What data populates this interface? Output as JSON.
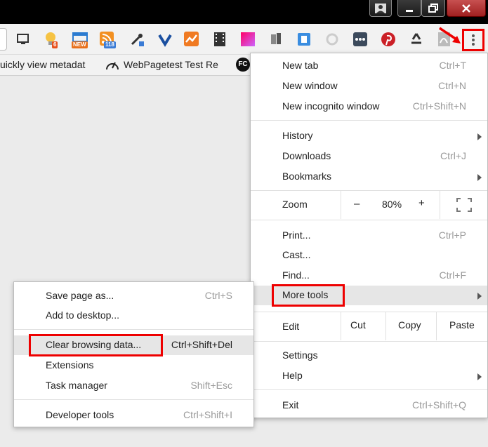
{
  "toolbar": {
    "badges": {
      "b1": "6",
      "b2": "NEW",
      "b3": "118"
    }
  },
  "bookmarks": {
    "item1": "uickly view metadat",
    "item2": "WebPagetest Test Re",
    "item3_icon_text": "FC"
  },
  "menu": {
    "new_tab": {
      "label": "New tab",
      "shortcut": "Ctrl+T"
    },
    "new_window": {
      "label": "New window",
      "shortcut": "Ctrl+N"
    },
    "incognito": {
      "label": "New incognito window",
      "shortcut": "Ctrl+Shift+N"
    },
    "history": {
      "label": "History"
    },
    "downloads": {
      "label": "Downloads",
      "shortcut": "Ctrl+J"
    },
    "bookmarks": {
      "label": "Bookmarks"
    },
    "zoom": {
      "label": "Zoom",
      "minus": "–",
      "value": "80%",
      "plus": "+"
    },
    "print": {
      "label": "Print...",
      "shortcut": "Ctrl+P"
    },
    "cast": {
      "label": "Cast..."
    },
    "find": {
      "label": "Find...",
      "shortcut": "Ctrl+F"
    },
    "more_tools": {
      "label": "More tools"
    },
    "edit": {
      "label": "Edit",
      "cut": "Cut",
      "copy": "Copy",
      "paste": "Paste"
    },
    "settings": {
      "label": "Settings"
    },
    "help": {
      "label": "Help"
    },
    "exit": {
      "label": "Exit",
      "shortcut": "Ctrl+Shift+Q"
    }
  },
  "submenu": {
    "save_page": {
      "label": "Save page as...",
      "shortcut": "Ctrl+S"
    },
    "add_desktop": {
      "label": "Add to desktop..."
    },
    "clear_data": {
      "label": "Clear browsing data...",
      "shortcut": "Ctrl+Shift+Del"
    },
    "extensions": {
      "label": "Extensions"
    },
    "task_manager": {
      "label": "Task manager",
      "shortcut": "Shift+Esc"
    },
    "dev_tools": {
      "label": "Developer tools",
      "shortcut": "Ctrl+Shift+I"
    }
  }
}
